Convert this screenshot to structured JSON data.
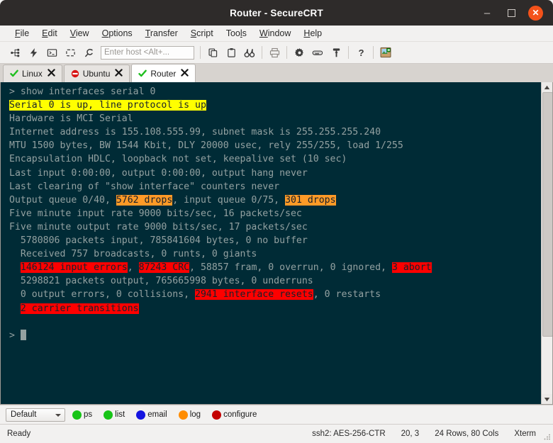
{
  "window": {
    "title": "Router - SecureCRT",
    "minimize_label": "–",
    "maximize_label": "",
    "close_label": "✕"
  },
  "menubar": {
    "items": [
      {
        "pre": "",
        "mnemonic": "F",
        "post": "ile"
      },
      {
        "pre": "",
        "mnemonic": "E",
        "post": "dit"
      },
      {
        "pre": "",
        "mnemonic": "V",
        "post": "iew"
      },
      {
        "pre": "",
        "mnemonic": "O",
        "post": "ptions"
      },
      {
        "pre": "",
        "mnemonic": "T",
        "post": "ransfer"
      },
      {
        "pre": "",
        "mnemonic": "S",
        "post": "cript"
      },
      {
        "pre": "Too",
        "mnemonic": "l",
        "post": "s"
      },
      {
        "pre": "",
        "mnemonic": "W",
        "post": "indow"
      },
      {
        "pre": "",
        "mnemonic": "H",
        "post": "elp"
      }
    ]
  },
  "toolbar": {
    "host_placeholder": "Enter host <Alt+...",
    "host_value": "",
    "icons": [
      "connect-icon",
      "quick-connect-icon",
      "connect-local-shell-icon",
      "reconnect-icon",
      "disconnect-icon",
      "copy-icon",
      "paste-icon",
      "find-icon",
      "print-icon",
      "session-options-icon",
      "keymap-editor-icon",
      "key-icon",
      "help-icon",
      "command-window-icon"
    ]
  },
  "tabs": [
    {
      "label": "Linux",
      "status": "connected",
      "close": "✕",
      "active": false
    },
    {
      "label": "Ubuntu",
      "status": "disconnected",
      "close": "✕",
      "active": false
    },
    {
      "label": "Router",
      "status": "connected",
      "close": "✕",
      "active": true
    }
  ],
  "terminal": {
    "prompt": ">",
    "command": "show interfaces serial 0",
    "lines": [
      [
        {
          "t": "> show interfaces serial 0",
          "h": "none"
        }
      ],
      [
        {
          "t": "Serial 0 is up, line protocol is up",
          "h": "yellow"
        }
      ],
      [
        {
          "t": "Hardware is MCI Serial",
          "h": "none"
        }
      ],
      [
        {
          "t": "Internet address is 155.108.555.99, subnet mask is 255.255.255.240",
          "h": "none"
        }
      ],
      [
        {
          "t": "MTU 1500 bytes, BW 1544 Kbit, DLY 20000 usec, rely 255/255, load 1/255",
          "h": "none"
        }
      ],
      [
        {
          "t": "Encapsulation HDLC, loopback not set, keepalive set (10 sec)",
          "h": "none"
        }
      ],
      [
        {
          "t": "Last input 0:00:00, output 0:00:00, output hang never",
          "h": "none"
        }
      ],
      [
        {
          "t": "Last clearing of \"show interface\" counters never",
          "h": "none"
        }
      ],
      [
        {
          "t": "Output queue 0/40, ",
          "h": "none"
        },
        {
          "t": "5762 drops",
          "h": "orange"
        },
        {
          "t": ", input queue 0/75, ",
          "h": "none"
        },
        {
          "t": "301 drops",
          "h": "orange"
        }
      ],
      [
        {
          "t": "Five minute input rate 9000 bits/sec, 16 packets/sec",
          "h": "none"
        }
      ],
      [
        {
          "t": "Five minute output rate 9000 bits/sec, 17 packets/sec",
          "h": "none"
        }
      ],
      [
        {
          "t": "  5780806 packets input, 785841604 bytes, 0 no buffer",
          "h": "none"
        }
      ],
      [
        {
          "t": "  Received 757 broadcasts, 0 runts, 0 giants",
          "h": "none"
        }
      ],
      [
        {
          "t": "  ",
          "h": "none"
        },
        {
          "t": "146124 input errors",
          "h": "red"
        },
        {
          "t": ", ",
          "h": "none"
        },
        {
          "t": "87243 CRC",
          "h": "red"
        },
        {
          "t": ", 58857 fram, 0 overrun, 0 ignored, ",
          "h": "none"
        },
        {
          "t": "3 abort",
          "h": "red"
        }
      ],
      [
        {
          "t": "  5298821 packets output, 765665998 bytes, 0 underruns",
          "h": "none"
        }
      ],
      [
        {
          "t": "  0 output errors, 0 collisions, ",
          "h": "none"
        },
        {
          "t": "2941 interface resets",
          "h": "red"
        },
        {
          "t": ", 0 restarts",
          "h": "none"
        }
      ],
      [
        {
          "t": "  ",
          "h": "none"
        },
        {
          "t": "2 carrier transitions",
          "h": "red"
        }
      ],
      [
        {
          "t": "",
          "h": "none"
        }
      ],
      [
        {
          "t": "> ",
          "h": "none",
          "cursor": true
        }
      ]
    ],
    "colors": {
      "background": "#002b36",
      "foreground": "#93a1a1",
      "highlight_yellow": "#ffff00",
      "highlight_orange": "#ff9a27",
      "highlight_red": "#fe0000",
      "highlight_text": "#17202a"
    }
  },
  "buttonbar": {
    "session_select": "Default",
    "buttons": [
      {
        "label": "ps",
        "color": "#17c417"
      },
      {
        "label": "list",
        "color": "#17c417"
      },
      {
        "label": "email",
        "color": "#1414e0"
      },
      {
        "label": "log",
        "color": "#ff8c00"
      },
      {
        "label": "configure",
        "color": "#c40000"
      }
    ]
  },
  "statusbar": {
    "state": "Ready",
    "protocol": "ssh2: AES-256-CTR",
    "cursor_position": "20,  3",
    "dimensions": "24 Rows, 80 Cols",
    "emulation": "Xterm"
  }
}
